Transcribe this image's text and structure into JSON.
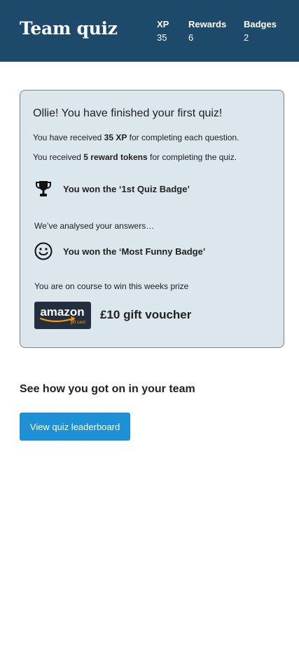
{
  "header": {
    "title": "Team quiz",
    "stats": [
      {
        "label": "XP",
        "value": "35"
      },
      {
        "label": "Rewards",
        "value": "6"
      },
      {
        "label": "Badges",
        "value": "2"
      }
    ]
  },
  "result_card": {
    "heading": "Ollie! You have finished your first quiz!",
    "xp_line": {
      "prefix": "You have received ",
      "highlight": "35 XP",
      "suffix": " for completing each question."
    },
    "tokens_line": {
      "prefix": "You received ",
      "highlight": "5 reward tokens",
      "suffix": " for completing the quiz."
    },
    "badge_award": {
      "icon": "trophy-icon",
      "text": "You won the ‘1st Quiz Badge’"
    },
    "analysed_note": "We’ve analysed your answers…",
    "funny_award": {
      "icon": "smiley-icon",
      "text": "You won the ‘Most Funny Badge’"
    },
    "prize_note": "You are on course to win this weeks prize",
    "prize": {
      "logo_text": "amazon",
      "logo_subtext": "gift card",
      "text": "£10 gift voucher"
    }
  },
  "team_section": {
    "heading": "See how you got on in your team",
    "button_label": "View quiz leaderboard"
  },
  "colors": {
    "header_bg": "#1d4a6b",
    "card_bg": "#dbe6ed",
    "button_bg": "#1e90d6",
    "amazon_orange": "#ff9900"
  }
}
